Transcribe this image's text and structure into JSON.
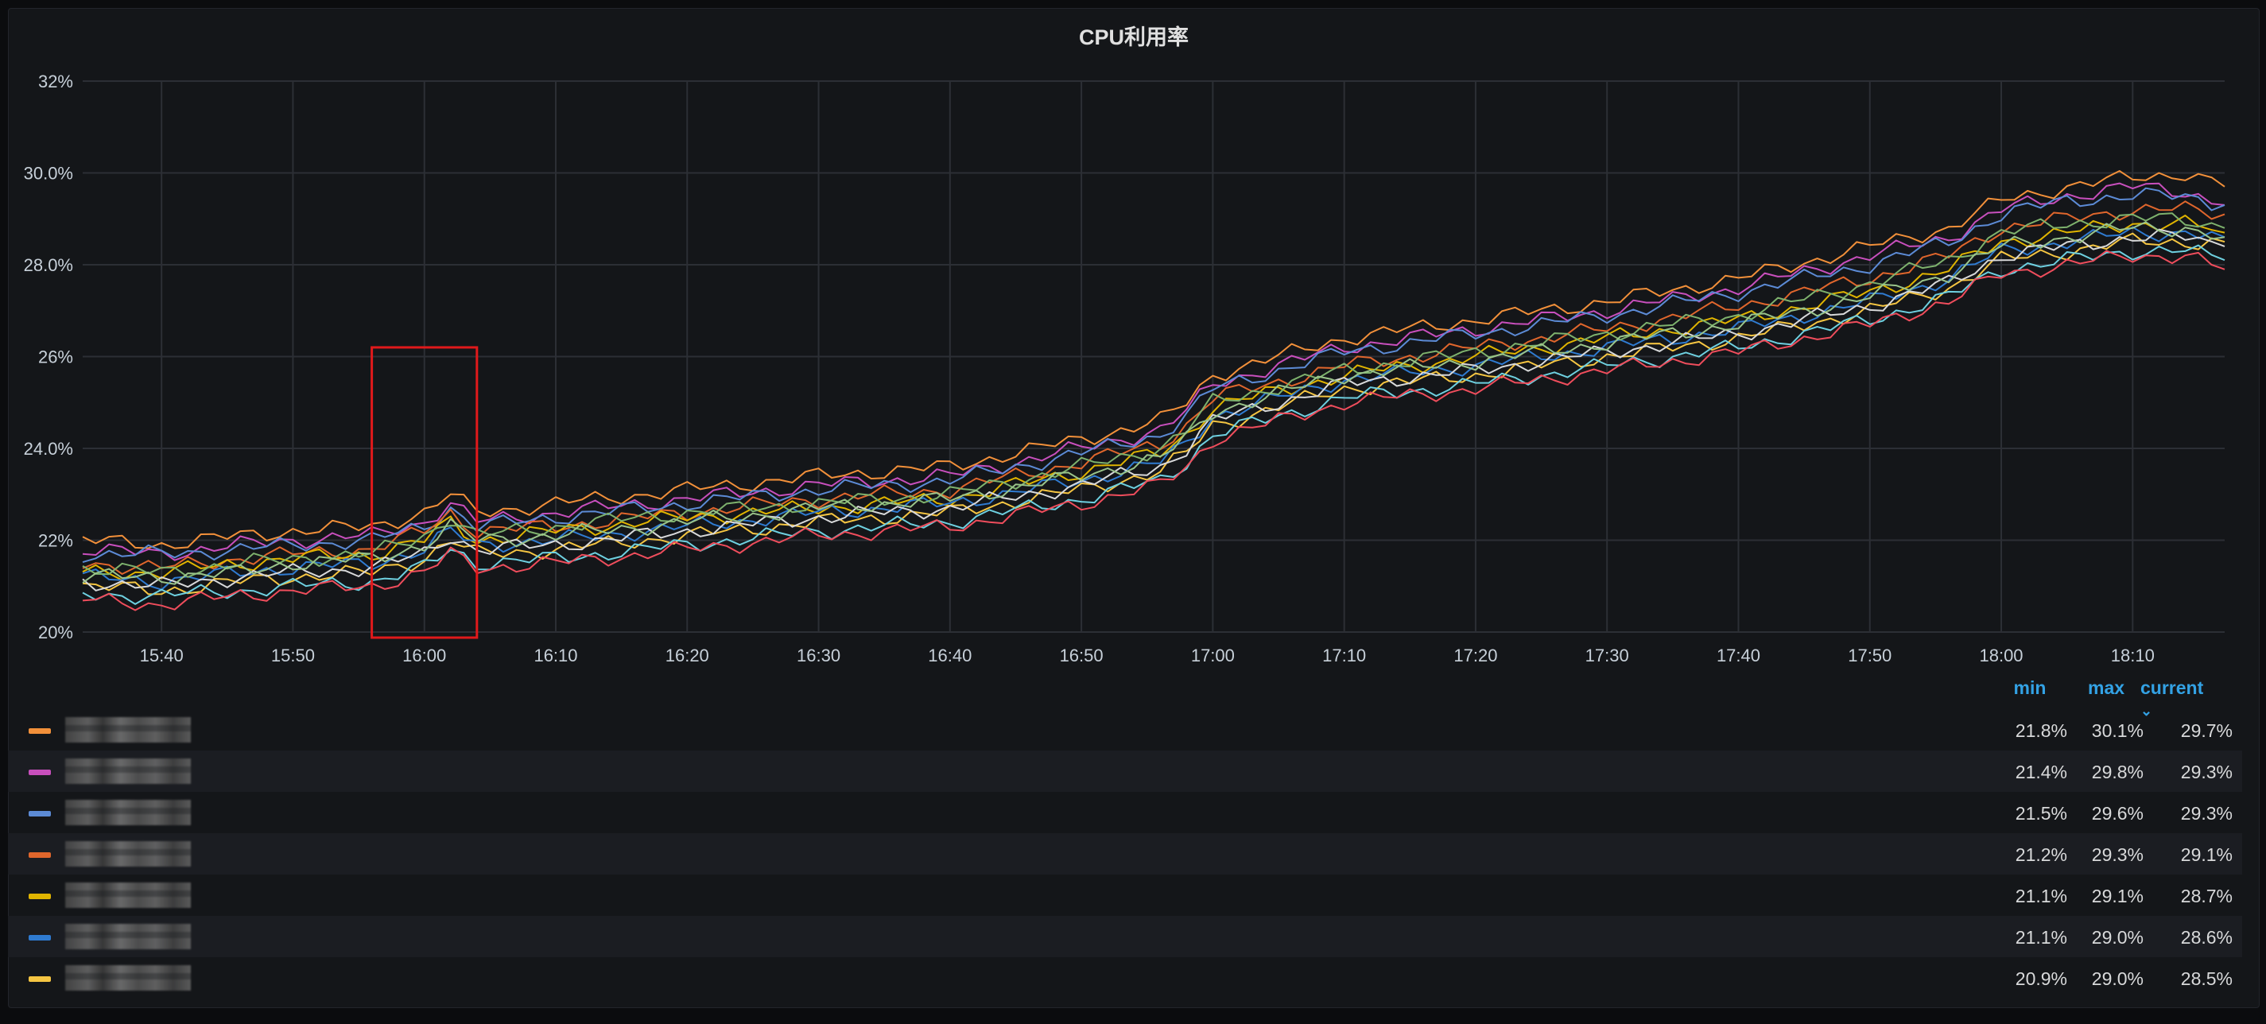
{
  "panel": {
    "title": "CPU利用率"
  },
  "legend": {
    "columns": {
      "min": "min",
      "max": "max",
      "current": "current"
    },
    "rows": [
      {
        "name": "",
        "color": "#f2903a",
        "min": "21.8%",
        "max": "30.1%",
        "current": "29.7%"
      },
      {
        "name": "",
        "color": "#c84fbd",
        "min": "21.4%",
        "max": "29.8%",
        "current": "29.3%"
      },
      {
        "name": "",
        "color": "#5c8bd6",
        "min": "21.5%",
        "max": "29.6%",
        "current": "29.3%"
      },
      {
        "name": "",
        "color": "#e0662c",
        "min": "21.2%",
        "max": "29.3%",
        "current": "29.1%"
      },
      {
        "name": "",
        "color": "#e0b400",
        "min": "21.1%",
        "max": "29.1%",
        "current": "28.7%"
      },
      {
        "name": "",
        "color": "#2f7bd1",
        "min": "21.1%",
        "max": "29.0%",
        "current": "28.6%"
      },
      {
        "name": "",
        "color": "#f5c542",
        "min": "20.9%",
        "max": "29.0%",
        "current": "28.5%"
      }
    ]
  },
  "chart_data": {
    "type": "line",
    "title": "CPU利用率",
    "xlabel": "",
    "ylabel": "",
    "ylim": [
      20,
      32
    ],
    "y_ticks": [
      "20%",
      "22%",
      "24.0%",
      "26%",
      "28.0%",
      "30.0%",
      "32%"
    ],
    "y_tick_values": [
      20,
      22,
      24,
      26,
      28,
      30,
      32
    ],
    "x_ticks": [
      "15:40",
      "15:50",
      "16:00",
      "16:10",
      "16:20",
      "16:30",
      "16:40",
      "16:50",
      "17:00",
      "17:10",
      "17:20",
      "17:30",
      "17:40",
      "17:50",
      "18:00",
      "18:10"
    ],
    "xlim": [
      "15:34",
      "18:17"
    ],
    "grid": true,
    "highlight_box": {
      "x_range": [
        "15:56",
        "16:04"
      ],
      "y_range": [
        20,
        26.2
      ],
      "color": "#e0191b"
    },
    "series_style": "7 hosts plus 5 similar unlisted hosts",
    "x": [
      "15:34",
      "15:40",
      "15:46",
      "15:50",
      "15:56",
      "16:00",
      "16:02",
      "16:04",
      "16:10",
      "16:20",
      "16:30",
      "16:40",
      "16:50",
      "16:56",
      "16:58",
      "17:00",
      "17:10",
      "17:20",
      "17:30",
      "17:40",
      "17:50",
      "17:56",
      "18:00",
      "18:05",
      "18:10",
      "18:14",
      "18:17"
    ],
    "series": [
      {
        "color": "#f2903a",
        "values": [
          22.0,
          21.9,
          22.1,
          22.2,
          22.3,
          22.6,
          23.0,
          22.6,
          22.8,
          23.1,
          23.4,
          23.6,
          24.2,
          24.6,
          25.0,
          25.6,
          26.4,
          26.8,
          27.2,
          27.7,
          28.4,
          28.8,
          29.4,
          29.7,
          29.9,
          30.0,
          29.7
        ]
      },
      {
        "color": "#c84fbd",
        "values": [
          21.8,
          21.7,
          21.9,
          22.0,
          22.1,
          22.4,
          22.8,
          22.4,
          22.6,
          22.9,
          23.2,
          23.4,
          24.0,
          24.4,
          24.8,
          25.4,
          26.2,
          26.6,
          27.0,
          27.5,
          28.2,
          28.6,
          29.2,
          29.5,
          29.7,
          29.6,
          29.3
        ]
      },
      {
        "color": "#5c8bd6",
        "values": [
          21.7,
          21.7,
          21.8,
          21.9,
          22.0,
          22.3,
          22.7,
          22.3,
          22.5,
          22.8,
          23.1,
          23.3,
          23.9,
          24.3,
          24.7,
          25.3,
          26.1,
          26.5,
          26.9,
          27.4,
          28.0,
          28.5,
          29.1,
          29.4,
          29.5,
          29.5,
          29.3
        ]
      },
      {
        "color": "#e0662c",
        "values": [
          21.5,
          21.4,
          21.6,
          21.7,
          21.8,
          22.2,
          22.6,
          22.2,
          22.3,
          22.6,
          22.9,
          23.1,
          23.7,
          24.1,
          24.5,
          25.1,
          25.8,
          26.2,
          26.6,
          27.1,
          27.7,
          28.2,
          28.8,
          29.0,
          29.2,
          29.2,
          29.1
        ]
      },
      {
        "color": "#e0b400",
        "values": [
          21.3,
          21.3,
          21.5,
          21.6,
          21.7,
          22.0,
          22.4,
          22.0,
          22.2,
          22.5,
          22.7,
          22.9,
          23.5,
          23.9,
          24.3,
          24.9,
          25.6,
          26.0,
          26.4,
          26.8,
          27.4,
          27.9,
          28.5,
          28.7,
          28.9,
          28.9,
          28.7
        ]
      },
      {
        "color": "#2f7bd1",
        "values": [
          21.2,
          21.1,
          21.3,
          21.4,
          21.5,
          21.8,
          22.2,
          21.9,
          22.0,
          22.3,
          22.6,
          22.8,
          23.3,
          23.7,
          24.1,
          24.7,
          25.5,
          25.8,
          26.2,
          26.6,
          27.2,
          27.7,
          28.3,
          28.5,
          28.7,
          28.7,
          28.6
        ]
      },
      {
        "color": "#f5c542",
        "values": [
          21.0,
          20.9,
          21.1,
          21.2,
          21.3,
          21.6,
          22.0,
          21.7,
          21.8,
          22.1,
          22.4,
          22.6,
          23.1,
          23.5,
          23.9,
          24.5,
          25.3,
          25.6,
          26.0,
          26.4,
          27.0,
          27.5,
          28.1,
          28.3,
          28.5,
          28.5,
          28.5
        ]
      },
      {
        "color": "#7eb26d",
        "values": [
          21.4,
          21.3,
          21.5,
          21.6,
          21.7,
          22.1,
          22.5,
          22.1,
          22.3,
          22.6,
          22.8,
          23.0,
          23.6,
          24.0,
          24.4,
          25.0,
          25.7,
          26.1,
          26.5,
          26.9,
          27.6,
          28.1,
          28.7,
          28.9,
          29.0,
          29.0,
          28.8
        ]
      },
      {
        "color": "#d8d9da",
        "values": [
          21.1,
          21.0,
          21.2,
          21.3,
          21.4,
          21.7,
          22.1,
          21.8,
          21.9,
          22.2,
          22.5,
          22.7,
          23.2,
          23.6,
          24.0,
          24.6,
          25.4,
          25.7,
          26.1,
          26.5,
          27.1,
          27.6,
          28.2,
          28.4,
          28.6,
          28.6,
          28.4
        ]
      },
      {
        "color": "#6ed0e0",
        "values": [
          20.8,
          20.8,
          20.9,
          21.0,
          21.1,
          21.4,
          21.8,
          21.5,
          21.6,
          21.9,
          22.2,
          22.4,
          22.9,
          23.3,
          23.7,
          24.3,
          25.1,
          25.4,
          25.8,
          26.2,
          26.8,
          27.3,
          27.9,
          28.1,
          28.3,
          28.3,
          28.1
        ]
      },
      {
        "color": "#ef4d5c",
        "values": [
          20.7,
          20.6,
          20.8,
          20.9,
          21.0,
          21.3,
          21.7,
          21.4,
          21.5,
          21.8,
          22.1,
          22.3,
          22.8,
          23.2,
          23.6,
          24.2,
          25.0,
          25.3,
          25.7,
          26.1,
          26.7,
          27.2,
          27.8,
          28.0,
          28.2,
          28.2,
          27.9
        ]
      },
      {
        "color": "#9ac48a",
        "values": [
          21.2,
          21.2,
          21.3,
          21.5,
          21.6,
          21.9,
          22.3,
          22.0,
          22.1,
          22.4,
          22.7,
          22.9,
          23.4,
          23.8,
          24.2,
          24.8,
          25.6,
          25.9,
          26.3,
          26.7,
          27.3,
          27.8,
          28.4,
          28.6,
          28.8,
          28.8,
          28.6
        ]
      }
    ]
  }
}
